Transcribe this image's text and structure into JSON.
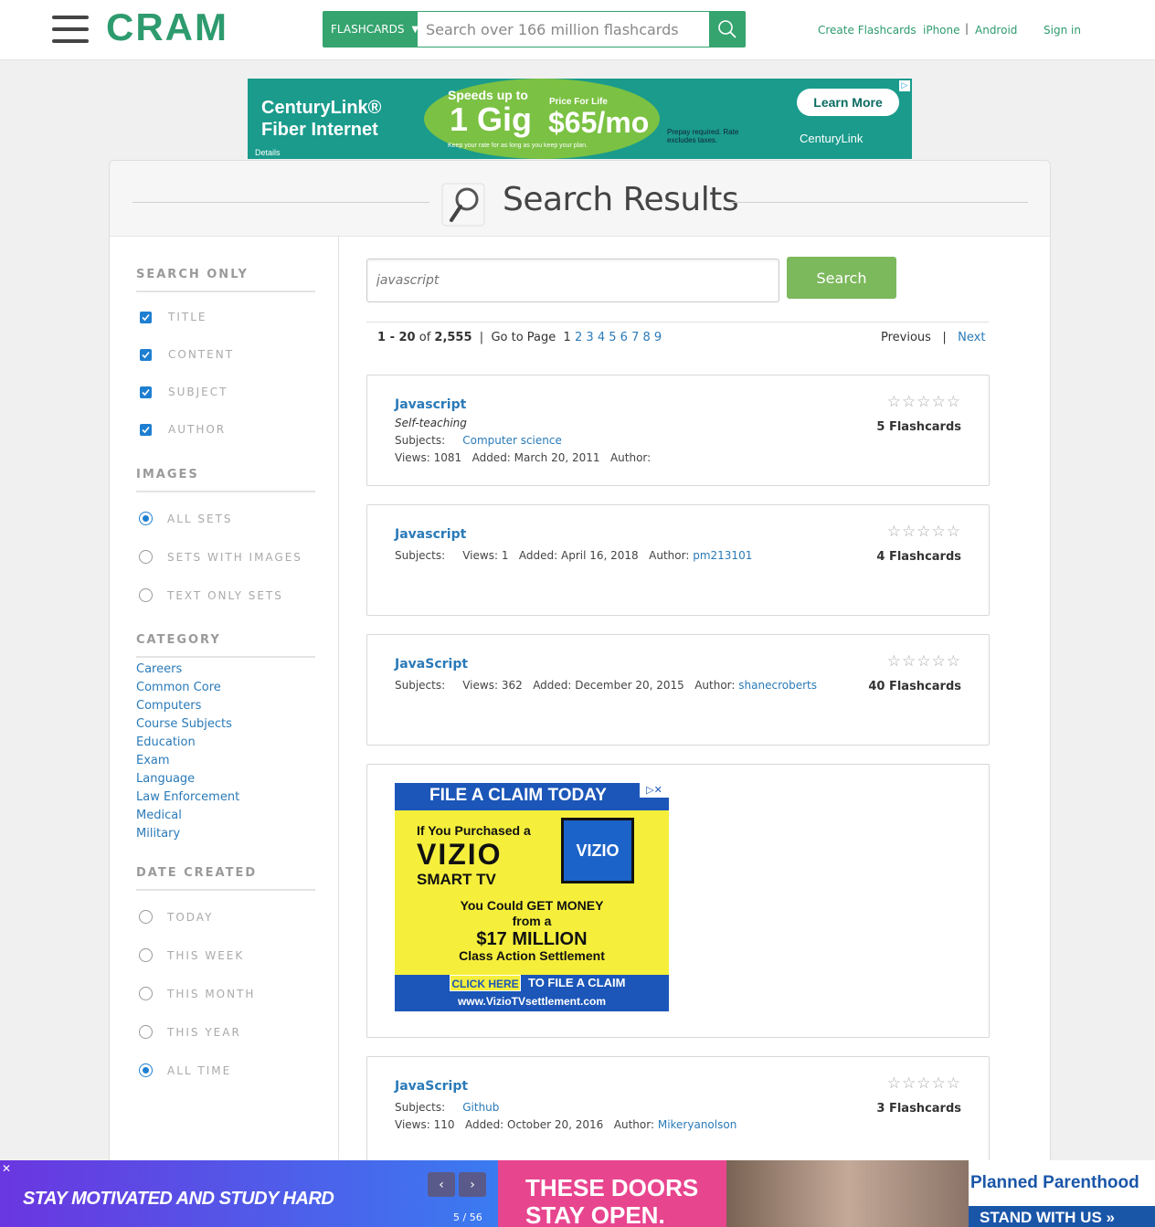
{
  "header": {
    "logo": "CRAM",
    "search_category": "FLASHCARDS",
    "search_placeholder": "Search over 166 million flashcards",
    "links": {
      "create": "Create Flashcards",
      "iphone": "iPhone",
      "android": "Android",
      "signin": "Sign in"
    }
  },
  "top_ad": {
    "brand_line1": "CenturyLink®",
    "brand_line2": "Fiber Internet",
    "details": "Details",
    "speeds": "Speeds up to",
    "gig": "1 Gig",
    "price_for_life": "Price For Life",
    "price": "$65/mo",
    "keep": "Keep your rate for as long as you keep your plan.",
    "prepay": "Prepay required. Rate excludes taxes.",
    "learn_more": "Learn More",
    "logo": "CenturyLink"
  },
  "page_title": "Search Results",
  "sidebar": {
    "search_only": {
      "title": "SEARCH ONLY",
      "options": [
        {
          "label": "TITLE",
          "checked": true
        },
        {
          "label": "CONTENT",
          "checked": true
        },
        {
          "label": "SUBJECT",
          "checked": true
        },
        {
          "label": "AUTHOR",
          "checked": true
        }
      ]
    },
    "images": {
      "title": "IMAGES",
      "options": [
        {
          "label": "ALL SETS",
          "selected": true
        },
        {
          "label": "SETS WITH IMAGES",
          "selected": false
        },
        {
          "label": "TEXT ONLY SETS",
          "selected": false
        }
      ]
    },
    "category": {
      "title": "CATEGORY",
      "items": [
        "Careers",
        "Common Core",
        "Computers",
        "Course Subjects",
        "Education",
        "Exam",
        "Language",
        "Law Enforcement",
        "Medical",
        "Military"
      ]
    },
    "date_created": {
      "title": "DATE CREATED",
      "options": [
        {
          "label": "TODAY",
          "selected": false
        },
        {
          "label": "THIS WEEK",
          "selected": false
        },
        {
          "label": "THIS MONTH",
          "selected": false
        },
        {
          "label": "THIS YEAR",
          "selected": false
        },
        {
          "label": "ALL TIME",
          "selected": true
        }
      ]
    }
  },
  "search": {
    "placeholder": "javascript",
    "button": "Search"
  },
  "pager": {
    "range": "1 - 20",
    "of": "of",
    "total": "2,555",
    "sep": "|",
    "goto": "Go to Page",
    "current": "1",
    "pages": [
      "2",
      "3",
      "4",
      "5",
      "6",
      "7",
      "8",
      "9"
    ],
    "previous": "Previous",
    "next": "Next"
  },
  "results": [
    {
      "title": "Javascript",
      "description": "Self-teaching",
      "subjects_label": "Subjects:",
      "subject": "Computer science",
      "views": "Views: 1081",
      "added": "Added: March 20, 2011",
      "author_label": "Author:",
      "author": "",
      "stars": "☆☆☆☆☆",
      "count": "5 Flashcards"
    },
    {
      "title": "Javascript",
      "subjects_label": "Subjects:",
      "views": "Views: 1",
      "added": "Added: April 16, 2018",
      "author_label": "Author:",
      "author": "pm213101",
      "stars": "☆☆☆☆☆",
      "count": "4 Flashcards"
    },
    {
      "title": "JavaScript",
      "subjects_label": "Subjects:",
      "views": "Views: 362",
      "added": "Added: December 20, 2015",
      "author_label": "Author:",
      "author": "shanecroberts",
      "stars": "☆☆☆☆☆",
      "count": "40 Flashcards"
    },
    {
      "title": "JavaScript",
      "subjects_label": "Subjects:",
      "subject": "Github",
      "views": "Views: 110",
      "added": "Added: October 20, 2016",
      "author_label": "Author:",
      "author": "Mikeryanolson",
      "stars": "☆☆☆☆☆",
      "count": "3 Flashcards"
    }
  ],
  "vizio_ad": {
    "head": "FILE A CLAIM TODAY",
    "line1": "If You Purchased a",
    "brand": "VIZIO",
    "line3": "SMART TV",
    "tv": "VIZIO",
    "line4a": "You Could GET MONEY",
    "line4b": "from a",
    "amount": "$17 MILLION",
    "settlement": "Class Action Settlement",
    "click": "CLICK HERE",
    "to_file": "TO FILE A CLAIM",
    "url": "www.VizioTVsettlement.com"
  },
  "bottom_banner": {
    "motto": "STAY MOTIVATED AND STUDY HARD",
    "page": "5 / 56",
    "doors": "THESE DOORS STAY OPEN.",
    "pp": "Planned Parenthood",
    "stand": "STAND WITH US »"
  },
  "colors": {
    "brand_green": "#2e9b6e",
    "link_blue": "#2a7ab8",
    "search_green": "#7cb85c",
    "check_blue": "#1e7fd1"
  }
}
